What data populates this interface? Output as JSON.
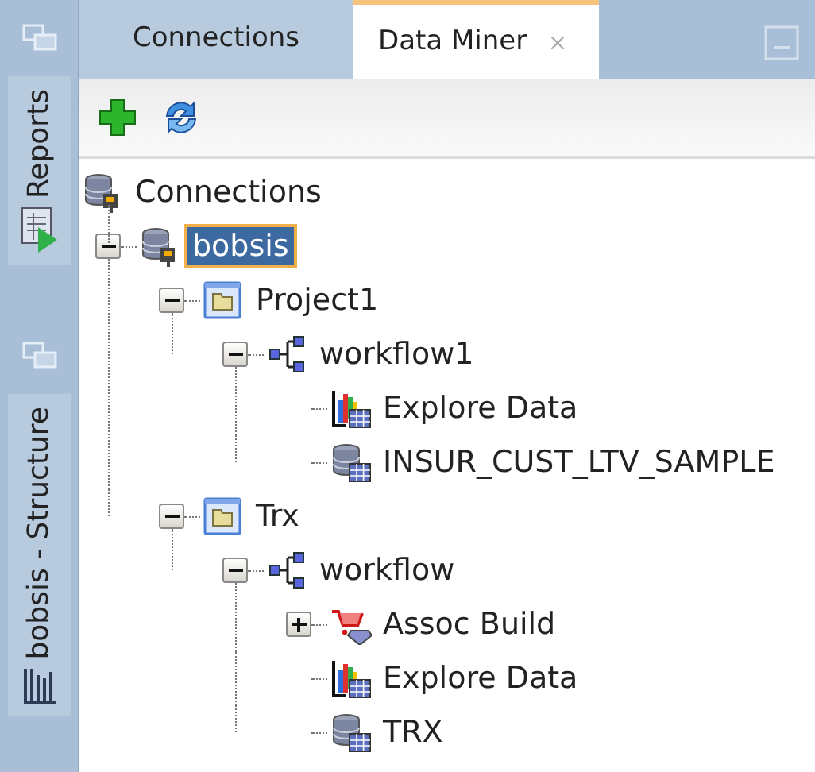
{
  "side_panels": [
    {
      "label": "Reports",
      "kind": "report"
    },
    {
      "label": "bobsis - Structure",
      "kind": "structure"
    }
  ],
  "tabs": [
    {
      "label": "Connections",
      "selected": false,
      "closable": false
    },
    {
      "label": "Data Miner",
      "selected": true,
      "closable": true
    }
  ],
  "toolbar": [
    {
      "kind": "add"
    },
    {
      "kind": "refresh"
    }
  ],
  "tree": [
    {
      "label": "Connections",
      "kind": "connections",
      "selected": false,
      "children": [
        {
          "label": "bobsis",
          "kind": "connection",
          "selected": true,
          "expanded": true,
          "children": [
            {
              "label": "Project1",
              "kind": "project",
              "selected": false,
              "expanded": true,
              "children": [
                {
                  "label": "workflow1",
                  "kind": "workflow",
                  "selected": false,
                  "expanded": true,
                  "children": [
                    {
                      "label": "Explore Data",
                      "kind": "explore",
                      "selected": false
                    },
                    {
                      "label": "INSUR_CUST_LTV_SAMPLE",
                      "kind": "table",
                      "selected": false
                    }
                  ]
                }
              ]
            },
            {
              "label": "Trx",
              "kind": "project",
              "selected": false,
              "expanded": true,
              "children": [
                {
                  "label": "workflow",
                  "kind": "workflow",
                  "selected": false,
                  "expanded": true,
                  "children": [
                    {
                      "label": "Assoc Build",
                      "kind": "assoc",
                      "selected": false,
                      "expanded": false
                    },
                    {
                      "label": "Explore Data",
                      "kind": "explore",
                      "selected": false
                    },
                    {
                      "label": "TRX",
                      "kind": "table",
                      "selected": false
                    }
                  ]
                }
              ]
            }
          ]
        }
      ]
    }
  ]
}
